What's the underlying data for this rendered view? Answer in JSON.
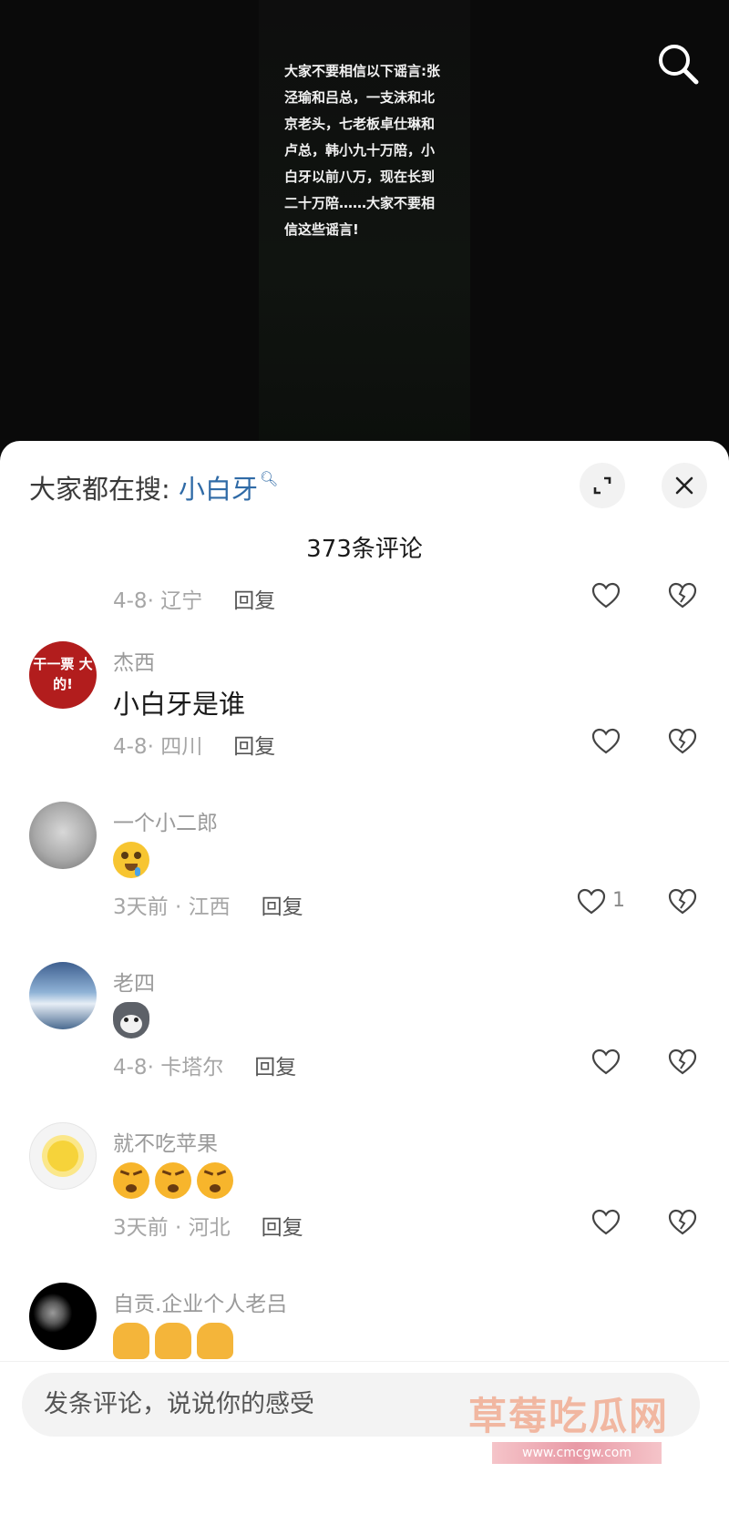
{
  "video": {
    "caption": "大家不要相信以下谣言:张泾瑜和吕总，一支沫和北京老头，七老板卓仕琳和卢总，韩小九十万陪，小白牙以前八万，现在长到二十万陪……大家不要相信这些谣言!"
  },
  "sheet": {
    "hot_search_label": "大家都在搜:",
    "hot_search_term": "小白牙",
    "comment_count": "373条评论"
  },
  "comments": [
    {
      "date": "4-8· 辽宁",
      "reply": "回复",
      "likes": ""
    },
    {
      "username": "杰西",
      "text": "小白牙是谁",
      "date": "4-8· 四川",
      "reply": "回复",
      "likes": "",
      "avatar_text": "干一票 大的!"
    },
    {
      "username": "一个小二郎",
      "date": "3天前 · 江西",
      "reply": "回复",
      "likes": "1",
      "emojis": [
        "drooling-face-emoji"
      ]
    },
    {
      "username": "老四",
      "date": "4-8· 卡塔尔",
      "reply": "回复",
      "likes": "",
      "emojis": [
        "husky-dog-emoji"
      ]
    },
    {
      "username": "就不吃苹果",
      "date": "3天前 · 河北",
      "reply": "回复",
      "likes": "",
      "emojis": [
        "angry-face-emoji",
        "angry-face-emoji",
        "angry-face-emoji"
      ]
    },
    {
      "username": "自贡.企业个人老吕",
      "emojis": [
        "thumbs-up-emoji",
        "thumbs-up-emoji",
        "thumbs-up-emoji"
      ]
    }
  ],
  "input": {
    "placeholder": "发条评论，说说你的感受"
  },
  "watermark": {
    "title": "草莓吃瓜网",
    "url": "www.cmcgw.com"
  },
  "colors": {
    "accent_link": "#2f6aa6",
    "meta_gray": "#a6a6a6",
    "text_dark": "#1a1a1a"
  }
}
